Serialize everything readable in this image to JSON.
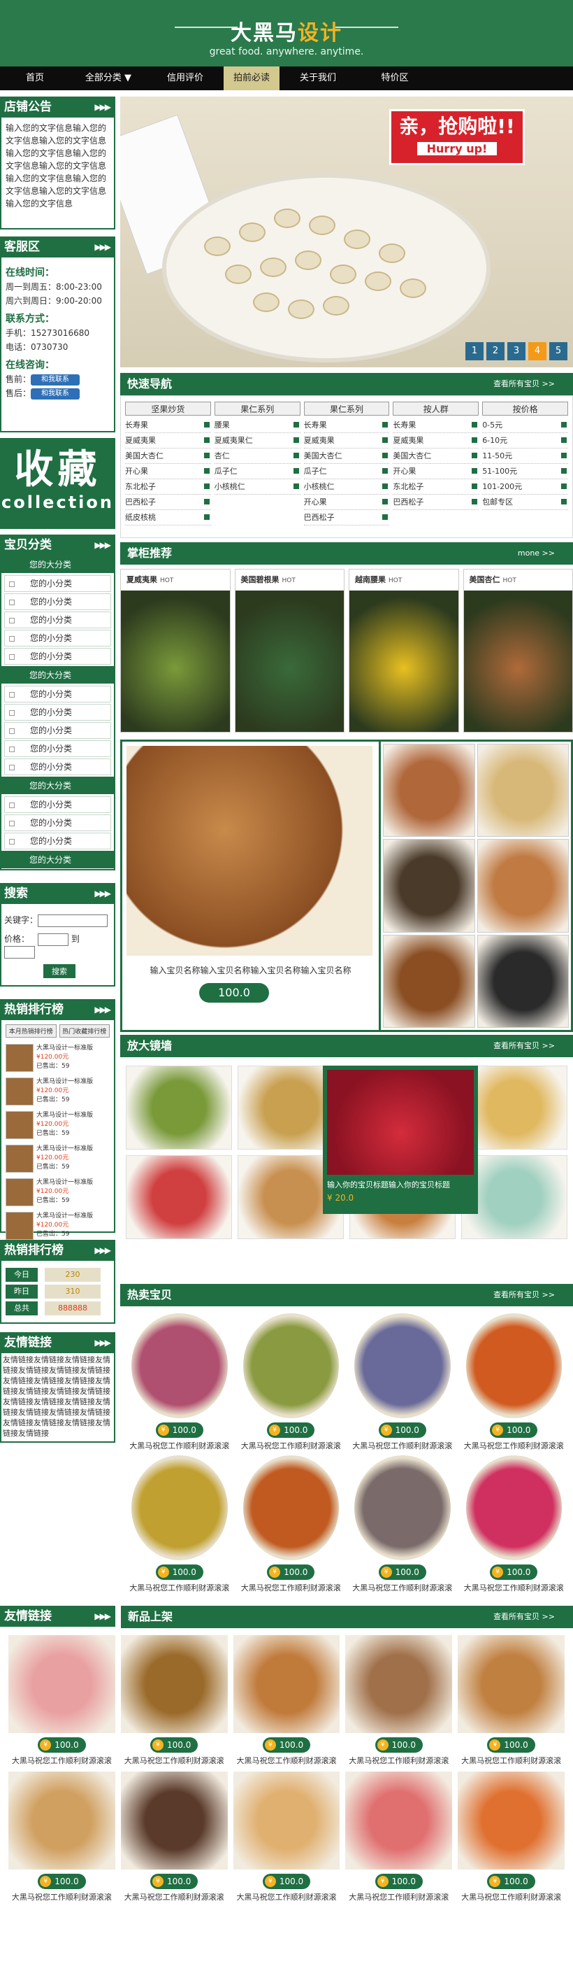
{
  "header": {
    "logo_main": "大黑马",
    "logo_accent": "设计",
    "tagline": "great food. anywhere. anytime."
  },
  "nav": {
    "items": [
      "首页",
      "全部分类 ▼",
      "信用评价",
      "拍前必读",
      "关于我们",
      "特价区"
    ],
    "active_index": 3
  },
  "sidebar": {
    "notice_title": "店铺公告",
    "notice_text": "输入您的文字信息输入您的文字信息输入您的文字信息输入您的文字信息输入您的文字信息输入您的文字信息输入您的文字信息输入您的文字信息输入您的文字信息输入您的文字信息",
    "service_title": "客服区",
    "online_label": "在线时间：",
    "online_1": "周一到周五：8:00-23:00",
    "online_2": "周六到周日：9:00-20:00",
    "contact_label": "联系方式：",
    "phone": "手机：15273016680",
    "tel": "电话：0730730",
    "consult_label": "在线咨询：",
    "presale": "售前：",
    "aftersale": "售后：",
    "ww_label": "和我联系",
    "fav_big": "收藏",
    "fav_small": "collection",
    "cat_title": "宝贝分类",
    "cat_big": "您的大分类",
    "cat_small": "您的小分类",
    "search_title": "搜索",
    "kw_label": "关键字：",
    "price_label": "价格：",
    "price_to": "到",
    "search_btn": "搜索",
    "hot_title": "热销排行榜",
    "hot_tab1": "本月热销排行榜",
    "hot_tab2": "热门收藏排行榜",
    "hot_item_name": "大黑马设计一标准版",
    "hot_item_price": "¥120.00元",
    "hot_item_sold": "已售出：59",
    "stat_title": "热销排行榜",
    "stats": [
      {
        "k": "今日",
        "v": "230"
      },
      {
        "k": "昨日",
        "v": "310"
      },
      {
        "k": "总共",
        "v": "888888"
      }
    ],
    "links_title": "友情链接",
    "links_text": "友情链接友情链接友情链接友情链接友情链接友情链接友情链接友情链接友情链接友情链接友情链接友情链接友情链接友情链接友情链接友情链接友情链接友情链接友情链接友情链接友情链接友情链接友情链接友情链接友情链接友情链接"
  },
  "banner": {
    "promo_1": "亲，抢购啦!!",
    "promo_2": "Hurry up!",
    "pages": [
      "1",
      "2",
      "3",
      "4",
      "5"
    ],
    "active_page": 4
  },
  "quicknav": {
    "title": "快速导航",
    "more": "查看所有宝贝 >>",
    "columns": [
      {
        "head": "坚果炒货",
        "items": [
          "长寿果",
          "夏威夷果",
          "美国大杏仁",
          "开心果",
          "东北松子",
          "巴西松子",
          "纸皮核桃"
        ]
      },
      {
        "head": "果仁系列",
        "items": [
          "腰果",
          "夏威夷果仁",
          "杏仁",
          "瓜子仁",
          "小核桃仁"
        ]
      },
      {
        "head": "果仁系列",
        "items": [
          "长寿果",
          "夏威夷果",
          "美国大杏仁",
          "瓜子仁",
          "小核桃仁",
          "开心果",
          "巴西松子"
        ]
      },
      {
        "head": "按人群",
        "items": [
          "长寿果",
          "夏威夷果",
          "美国大杏仁",
          "开心果",
          "东北松子",
          "巴西松子"
        ]
      },
      {
        "head": "按价格",
        "items": [
          "0-5元",
          "6-10元",
          "11-50元",
          "51-100元",
          "101-200元",
          "包邮专区"
        ]
      }
    ]
  },
  "recommend": {
    "title": "掌柜推荐",
    "more": "mone >>",
    "cards": [
      {
        "name": "夏威夷果",
        "hot": "HOT",
        "color": "#7a9a3a"
      },
      {
        "name": "美国碧根果",
        "hot": "HOT",
        "color": "#3a6a3a"
      },
      {
        "name": "越南腰果",
        "hot": "HOT",
        "color": "#e8c020"
      },
      {
        "name": "美国杏仁",
        "hot": "HOT",
        "color": "#b06a3a"
      }
    ]
  },
  "featured": {
    "caption": "输入宝贝名称输入宝贝名称输入宝贝名称输入宝贝名称",
    "price": "100.0",
    "thumb_colors": [
      "#b0673a",
      "#d8b878",
      "#4a3a2a",
      "#c07a42",
      "#8a4e22",
      "#2a2a2a"
    ]
  },
  "zoom": {
    "title": "放大镜墙",
    "more": "查看所有宝贝 >>",
    "pop_title": "输入你的宝贝标题输入你的宝贝标题",
    "pop_price": "¥ 20.0",
    "colors": [
      "#7a9a3a",
      "#c8a050",
      "#e0a820",
      "#e0b860",
      "#d04040",
      "#c89050",
      "#c88040",
      "#a0d0c0"
    ]
  },
  "hotsale": {
    "title": "热卖宝贝",
    "more": "查看所有宝贝 >>",
    "price": "100.0",
    "name": "大黑马祝您工作顺利财源滚滚",
    "colors": [
      "#b05070",
      "#8a9a40",
      "#6a6a9a",
      "#d05a20",
      "#c0a030",
      "#c05a20",
      "#7a6a6a",
      "#d03060"
    ]
  },
  "newitems": {
    "title": "新品上架",
    "more": "查看所有宝贝 >>",
    "left_title": "友情链接",
    "price": "100.0",
    "name": "大黑马祝您工作顺利财源滚滚",
    "colors": [
      "#e8a0a0",
      "#9a6a2a",
      "#c07a3a",
      "#a0704a",
      "#c08040",
      "#d0a060",
      "#5a3a2a",
      "#e0b070",
      "#e07070",
      "#e07030"
    ]
  }
}
